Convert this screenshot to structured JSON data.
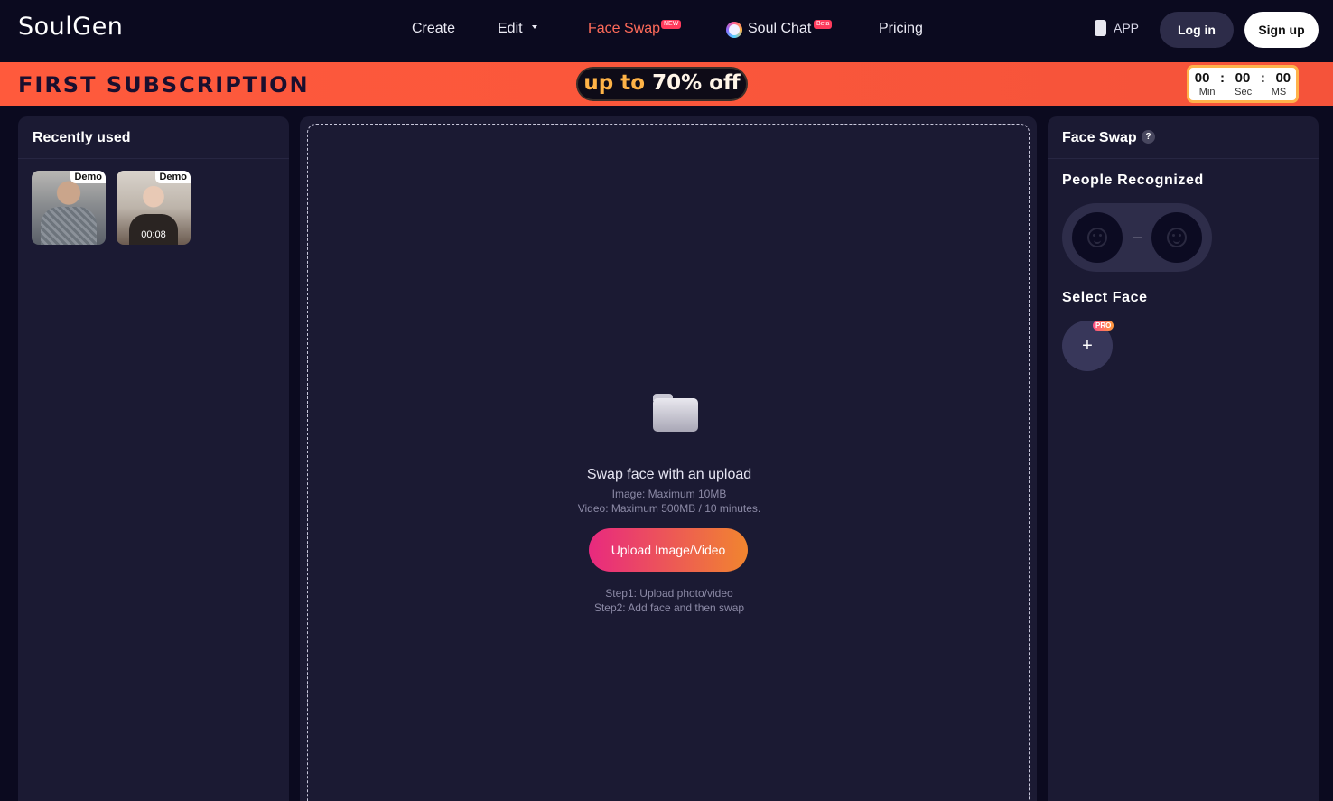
{
  "nav": {
    "logo": "SoulGen",
    "links": [
      {
        "label": "Create"
      },
      {
        "label": "Edit"
      },
      {
        "label": "Face Swap",
        "badge": "NEW"
      },
      {
        "label": "Soul Chat",
        "badge": "Beta"
      },
      {
        "label": "Pricing"
      }
    ],
    "app_label": "APP",
    "login_label": "Log in",
    "signup_label": "Sign up"
  },
  "promo": {
    "title": "FIRST SUBSCRIPTION",
    "offer_prefix": "up to",
    "offer_value": "70% off",
    "timer": {
      "min": "00",
      "sec": "00",
      "ms": "00",
      "separator": ":",
      "min_label": "Min",
      "sec_label": "Sec",
      "ms_label": "MS"
    }
  },
  "left": {
    "title": "Recently used",
    "items": [
      {
        "tag": "Demo",
        "duration": ""
      },
      {
        "tag": "Demo",
        "duration": "00:08"
      }
    ]
  },
  "center": {
    "title": "Swap face with an upload",
    "image_limit": "Image: Maximum 10MB",
    "video_limit": "Video: Maximum 500MB / 10 minutes.",
    "upload_label": "Upload Image/Video",
    "step1": "Step1: Upload photo/video",
    "step2": "Step2: Add face and then swap"
  },
  "right": {
    "title": "Face Swap",
    "help": "?",
    "people_label": "People Recognized",
    "select_label": "Select Face",
    "add_symbol": "+",
    "pro_badge": "PRO"
  },
  "colors": {
    "background": "#0b0a1f",
    "panel": "#1b1a33",
    "promo": "#f5533a",
    "accent_active": "#ff6b5a",
    "upload_gradient_start": "#e8297f",
    "upload_gradient_end": "#f1852f"
  },
  "icons": [
    "chevron-down-icon",
    "chat-bubble-icon",
    "phone-icon",
    "folder-icon",
    "help-icon",
    "face-placeholder-icon",
    "plus-icon"
  ]
}
